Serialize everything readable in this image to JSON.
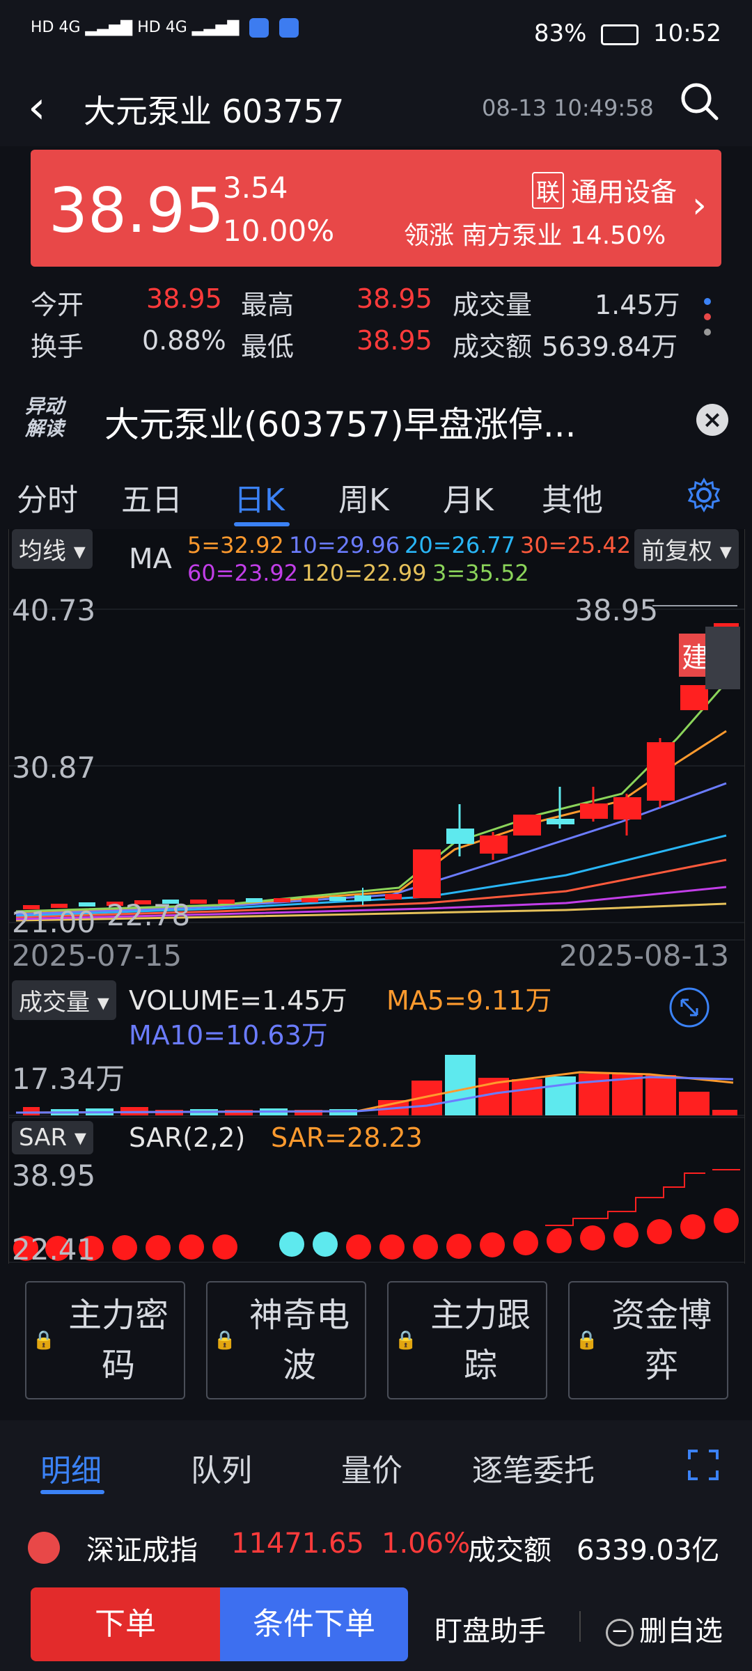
{
  "status": {
    "net1": "HD 4G",
    "net2": "HD 4G",
    "battery": "83%",
    "time": "10:52"
  },
  "header": {
    "title": "大元泵业 603757",
    "datetime": "08-13 10:49:58"
  },
  "quote": {
    "price": "38.95",
    "change": "3.54",
    "pct": "10.00%",
    "tag_icon": "联",
    "sector": "通用设备",
    "leader": "领涨 南方泵业 14.50%"
  },
  "stats": {
    "open_label": "今开",
    "open": "38.95",
    "high_label": "最高",
    "high": "38.95",
    "vol_label": "成交量",
    "vol": "1.45万",
    "turn_label": "换手",
    "turn": "0.88%",
    "low_label": "最低",
    "low": "38.95",
    "amt_label": "成交额",
    "amt": "5639.84万"
  },
  "news": {
    "badge1": "异动",
    "badge2": "解读",
    "text": "大元泵业(603757)早盘涨停..."
  },
  "tabs": [
    "分时",
    "五日",
    "日K",
    "周K",
    "月K",
    "其他"
  ],
  "chart": {
    "ma_label": "均线",
    "ma_title": "MA",
    "ma5": "5=32.92",
    "ma10": "10=29.96",
    "ma20": "20=26.77",
    "ma30": "30=25.42",
    "ma60": "60=23.92",
    "ma120": "120=22.99",
    "ma3": "3=35.52",
    "adj": "前复权",
    "y_top": "40.73",
    "y_mid": "30.87",
    "y_low": "21.00",
    "low_mark": "22.78",
    "high_mark": "38.95",
    "build": "建",
    "date_start": "2025-07-15",
    "date_end": "2025-08-13",
    "vol_label": "成交量",
    "vol_text": "VOLUME=1.45万",
    "vol_ma5": "MA5=9.11万",
    "vol_ma10": "MA10=10.63万",
    "vol_max": "17.34万",
    "sar_label": "SAR",
    "sar_title": "SAR(2,2)",
    "sar_value": "SAR=28.23",
    "sar_top": "38.95",
    "sar_low": "22.41"
  },
  "locks": [
    "主力密码",
    "神奇电波",
    "主力跟踪",
    "资金博弈"
  ],
  "detail_tabs": [
    "明细",
    "队列",
    "量价",
    "逐笔委托"
  ],
  "ticker": {
    "name": "深证成指",
    "value": "11471.65",
    "pct": "1.06%",
    "amt_label": "成交额",
    "amt": "6339.03亿"
  },
  "bottom": {
    "order": "下单",
    "cond": "条件下单",
    "assist": "盯盘助手",
    "remove": "删自选"
  },
  "colors": {
    "red": "#e84848",
    "up": "#ff2020",
    "down": "#5ee9ee",
    "ma5": "#ff9a2e",
    "ma10": "#6b7cff",
    "ma20": "#29b6f6",
    "ma30": "#ff5a3c",
    "ma60": "#c23ee8",
    "ma120": "#e6c15a",
    "ma3": "#8bd45a"
  }
}
